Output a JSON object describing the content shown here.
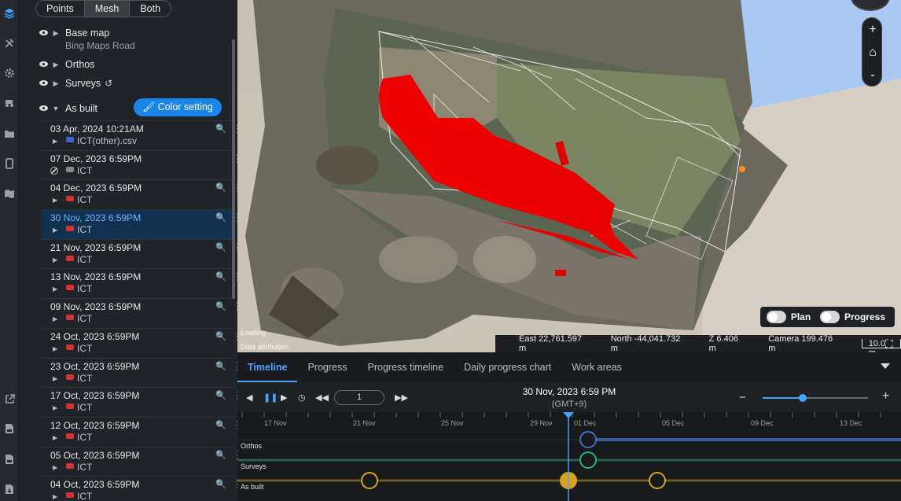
{
  "layer_panel": {
    "view_modes": [
      "Points",
      "Mesh",
      "Both"
    ],
    "active_view_mode": "Mesh",
    "layers": [
      {
        "label": "Base map",
        "sublabel": "Bing Maps Road"
      },
      {
        "label": "Orthos",
        "sublabel": ""
      },
      {
        "label": "Surveys",
        "sublabel": ""
      },
      {
        "label": "As built",
        "sublabel": ""
      }
    ],
    "color_setting_label": "Color setting",
    "surveys": [
      {
        "date": "03 Apr, 2024 10:21AM",
        "name": "ICT(other).csv",
        "type": "blue",
        "zoom": true,
        "caret": true
      },
      {
        "date": "07 Dec, 2023 6:59PM",
        "name": "ICT",
        "type": "gray",
        "zoom": false,
        "caret": false
      },
      {
        "date": "04 Dec, 2023 6:59PM",
        "name": "ICT",
        "type": "red",
        "zoom": true,
        "caret": true
      },
      {
        "date": "30 Nov, 2023 6:59PM",
        "name": "ICT",
        "type": "red",
        "zoom": true,
        "caret": true
      },
      {
        "date": "21 Nov, 2023 6:59PM",
        "name": "ICT",
        "type": "red",
        "zoom": true,
        "caret": true
      },
      {
        "date": "13 Nov, 2023 6:59PM",
        "name": "ICT",
        "type": "red",
        "zoom": true,
        "caret": true
      },
      {
        "date": "09 Nov, 2023 6:59PM",
        "name": "ICT",
        "type": "red",
        "zoom": true,
        "caret": true
      },
      {
        "date": "24 Oct, 2023 6:59PM",
        "name": "ICT",
        "type": "red",
        "zoom": true,
        "caret": true
      },
      {
        "date": "23 Oct, 2023 6:59PM",
        "name": "ICT",
        "type": "red",
        "zoom": true,
        "caret": true
      },
      {
        "date": "17 Oct, 2023 6:59PM",
        "name": "ICT",
        "type": "red",
        "zoom": true,
        "caret": true
      },
      {
        "date": "12 Oct, 2023 6:59PM",
        "name": "ICT",
        "type": "red",
        "zoom": true,
        "caret": true
      },
      {
        "date": "05 Oct, 2023 6:59PM",
        "name": "ICT",
        "type": "red",
        "zoom": true,
        "caret": true
      },
      {
        "date": "04 Oct, 2023 6:59PM",
        "name": "ICT",
        "type": "red",
        "zoom": true,
        "caret": true
      }
    ],
    "selected_survey": "30 Nov, 2023 6:59PM"
  },
  "map": {
    "zoom_in": "+",
    "zoom_out": "-",
    "plan_label": "Plan",
    "progress_label": "Progress",
    "loading_text": "Loading",
    "attribution_text": "Data attribution",
    "east": "East 22,761.597 m",
    "north": "North -44,041.732 m",
    "z": "Z 6.406 m",
    "camera": "Camera 199.476 m",
    "scale": "10.0 m"
  },
  "timeline": {
    "tabs": [
      "Timeline",
      "Progress",
      "Progress timeline",
      "Daily progress chart",
      "Work areas"
    ],
    "active_tab": "Timeline",
    "frame_value": "1",
    "current_date": "30 Nov, 2023 6:59 PM",
    "timezone": "(GMT+9)",
    "zoom_level": 0.38,
    "tick_labels": [
      "17 Nov",
      "21 Nov",
      "25 Nov",
      "29 Nov",
      "01 Dec",
      "05 Dec",
      "09 Dec",
      "13 Dec"
    ],
    "rows": [
      "Orthos",
      "Surveys",
      "As built"
    ],
    "colors": {
      "orthos": "#3d6fc4",
      "surveys": "#2fae7a",
      "asbuilt": "#d9a21b",
      "cursor": "#3ea6ff"
    }
  }
}
